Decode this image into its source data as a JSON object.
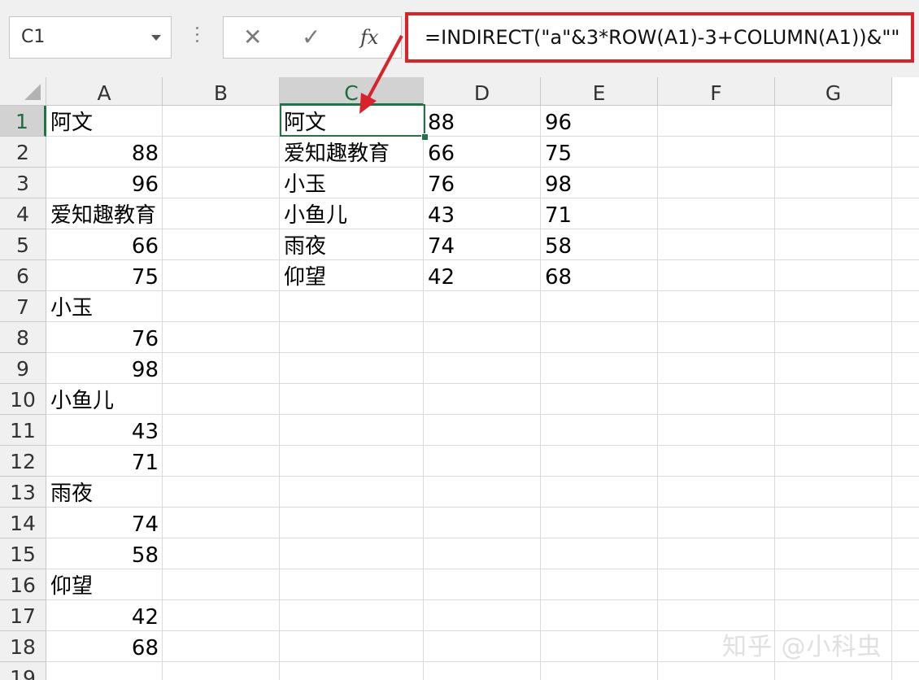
{
  "name_box": {
    "value": "C1"
  },
  "formula_bar": {
    "cancel_icon": "✕",
    "enter_icon": "✓",
    "fx_icon": "fx",
    "formula": "=INDIRECT(\"a\"&3*ROW(A1)-3+COLUMN(A1))&\"\""
  },
  "columns": [
    "A",
    "B",
    "C",
    "D",
    "E",
    "F",
    "G"
  ],
  "rows": [
    "1",
    "2",
    "3",
    "4",
    "5",
    "6",
    "7",
    "8",
    "9",
    "10",
    "11",
    "12",
    "13",
    "14",
    "15",
    "16",
    "17",
    "18",
    "19"
  ],
  "selected_cell": "C1",
  "column_a": [
    "阿文",
    "88",
    "96",
    "爱知趣教育",
    "66",
    "75",
    "小玉",
    "76",
    "98",
    "小鱼儿",
    "43",
    "71",
    "雨夜",
    "74",
    "58",
    "仰望",
    "42",
    "68"
  ],
  "result_table": [
    {
      "name": "阿文",
      "d": "88",
      "e": "96"
    },
    {
      "name": "爱知趣教育",
      "d": "66",
      "e": "75"
    },
    {
      "name": "小玉",
      "d": "76",
      "e": "98"
    },
    {
      "name": "小鱼儿",
      "d": "43",
      "e": "71"
    },
    {
      "name": "雨夜",
      "d": "74",
      "e": "58"
    },
    {
      "name": "仰望",
      "d": "42",
      "e": "68"
    }
  ],
  "watermark": "知乎 @小科虫",
  "colors": {
    "accent_green": "#217346",
    "highlight_red": "#d8232a"
  }
}
